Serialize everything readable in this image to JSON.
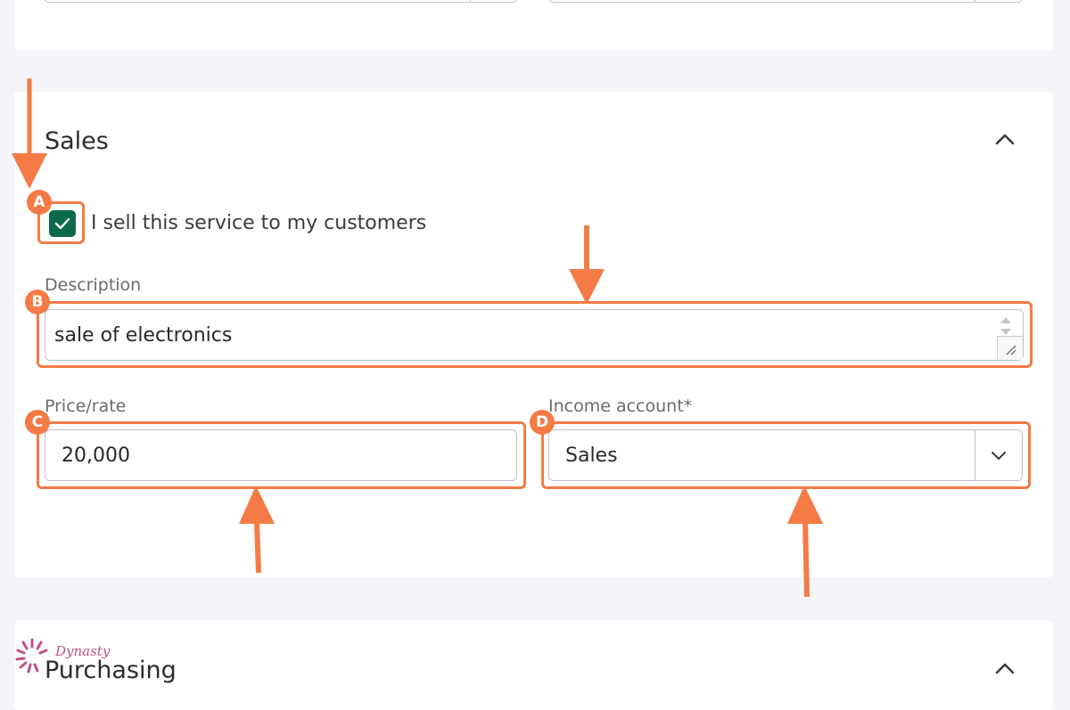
{
  "sales": {
    "title": "Sales",
    "checkbox_label": "I sell this service to my customers",
    "checkbox_checked": true,
    "description": {
      "label": "Description",
      "value": "sale of electronics"
    },
    "price": {
      "label": "Price/rate",
      "value": "20,000"
    },
    "income_account": {
      "label": "Income account*",
      "selected": "Sales"
    }
  },
  "purchasing": {
    "title": "Purchasing"
  },
  "annotations": {
    "badges": [
      "A",
      "B",
      "C",
      "D"
    ],
    "color": "#f47b46"
  },
  "colors": {
    "checkbox": "#0c6a4b",
    "field_border": "#bdc1c7",
    "background": "#f4f5f8"
  },
  "watermark": {
    "text": "Dynasty"
  },
  "icons": {
    "collapse": "chevron-up-icon",
    "dropdown": "chevron-down-icon",
    "check": "check-icon"
  }
}
